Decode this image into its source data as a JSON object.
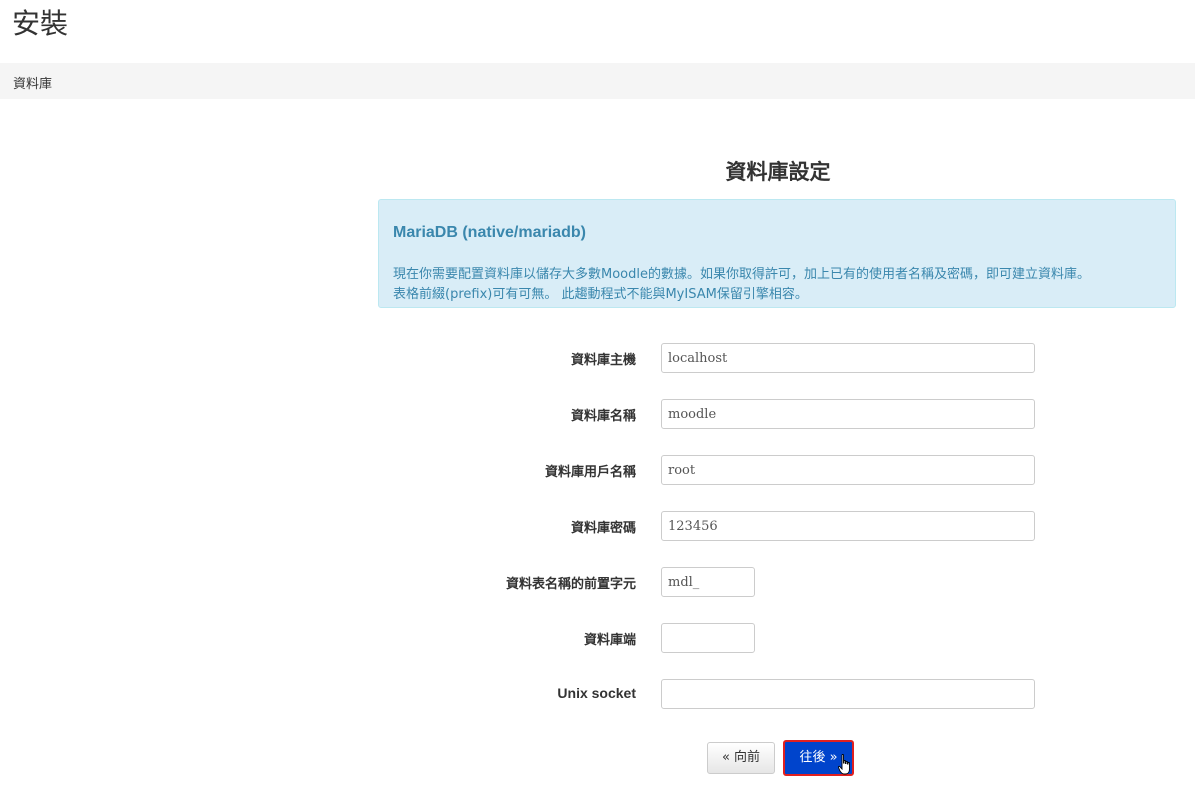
{
  "header": {
    "title": "安裝"
  },
  "breadcrumb": {
    "current": "資料庫"
  },
  "main": {
    "section_title": "資料庫設定",
    "info": {
      "title": "MariaDB (native/mariadb)",
      "line1": "現在你需要配置資料庫以儲存大多數Moodle的數據。如果你取得許可，加上已有的使用者名稱及密碼，即可建立資料庫。",
      "line2": "表格前綴(prefix)可有可無。 此趨動程式不能與MyISAM保留引擎相容。"
    },
    "fields": {
      "dbhost": {
        "label": "資料庫主機",
        "value": "localhost"
      },
      "dbname": {
        "label": "資料庫名稱",
        "value": "moodle"
      },
      "dbuser": {
        "label": "資料庫用戶名稱",
        "value": "root"
      },
      "dbpass": {
        "label": "資料庫密碼",
        "value": "123456"
      },
      "prefix": {
        "label": "資料表名稱的前置字元",
        "value": "mdl_"
      },
      "dbport": {
        "label": "資料庫端",
        "value": ""
      },
      "dbsocket": {
        "label": "Unix socket",
        "value": ""
      }
    },
    "buttons": {
      "previous": "« 向前",
      "next": "往後 »"
    }
  },
  "colors": {
    "info_bg": "#d9edf7",
    "info_text": "#3a87ad",
    "primary_button": "#0044cc",
    "highlight_border": "#e02020"
  }
}
